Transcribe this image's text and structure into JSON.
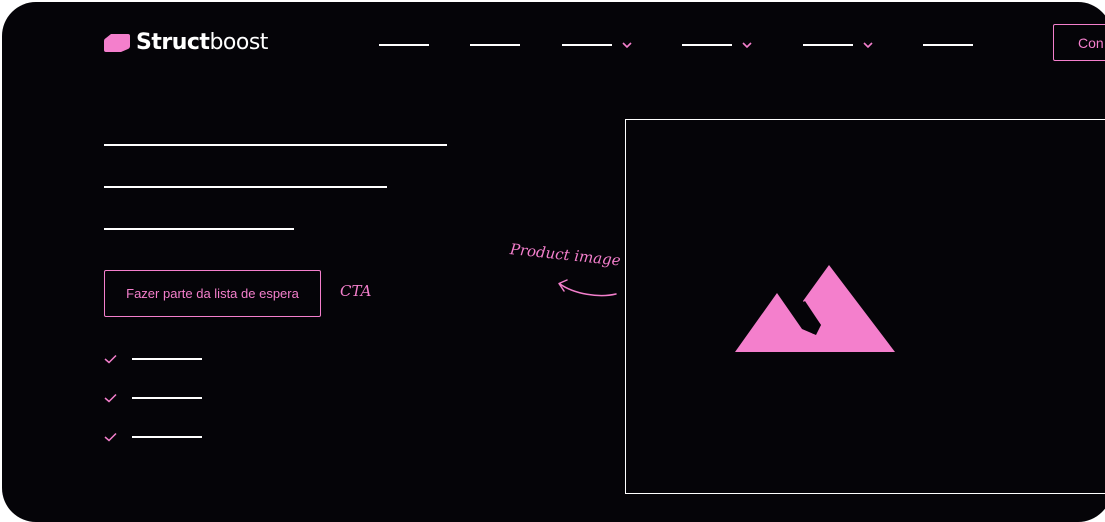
{
  "header": {
    "logo": {
      "bold": "Struct",
      "light": "boost",
      "icon": "logo-mark-icon"
    },
    "nav": [
      {
        "id": "nav-item-1",
        "has_dropdown": false
      },
      {
        "id": "nav-item-2",
        "has_dropdown": false
      },
      {
        "id": "nav-item-3",
        "has_dropdown": true,
        "icon": "chevron-down-icon"
      },
      {
        "id": "nav-item-4",
        "has_dropdown": true,
        "icon": "chevron-down-icon"
      },
      {
        "id": "nav-item-5",
        "has_dropdown": true,
        "icon": "chevron-down-icon"
      },
      {
        "id": "nav-item-6",
        "has_dropdown": false
      }
    ],
    "cta_label": "Con"
  },
  "hero": {
    "heading_line_count": 3,
    "cta_label": "Fazer parte da lista de espera",
    "cta_annotation": "CTA",
    "features": [
      {
        "icon": "check-icon"
      },
      {
        "icon": "check-icon"
      },
      {
        "icon": "check-icon"
      }
    ]
  },
  "product": {
    "annotation": "Product image",
    "image_icon": "mountain-image-icon",
    "arrow_icon": "curved-arrow-icon"
  },
  "colors": {
    "background": "#050408",
    "accent": "#f47fcc",
    "placeholder_lines": "#ffffff"
  }
}
